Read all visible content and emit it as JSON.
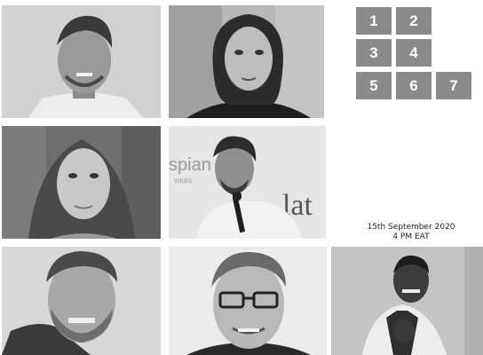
{
  "grid_numbers": [
    "1",
    "2",
    "3",
    "4",
    "5",
    "6",
    "7"
  ],
  "event": {
    "date": "15th September 2020",
    "time": "4 PM EAT"
  },
  "colors": {
    "tile": "#8a8a8a",
    "tile_text": "#ffffff",
    "photo_tint": "grayscale"
  },
  "photo_backdrop_text": {
    "left_letters": "spian",
    "left_small": "WEEK",
    "right_letters": "lat"
  }
}
